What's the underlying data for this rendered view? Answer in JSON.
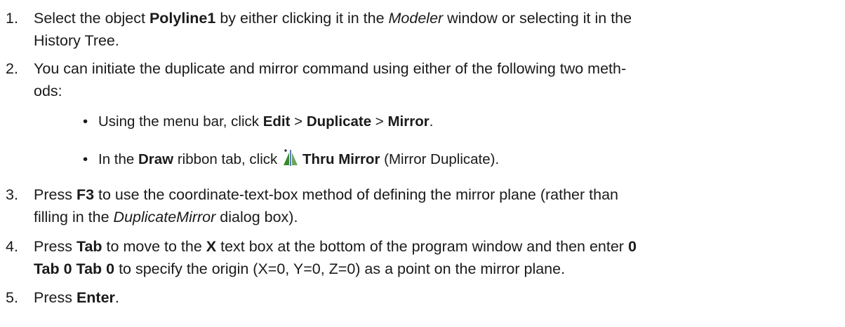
{
  "steps": [
    {
      "number": "1.",
      "parts": [
        "Select the object ",
        "Polyline1",
        " by either clicking it in the ",
        "Modeler",
        " window or selecting it in the",
        "History Tree."
      ]
    },
    {
      "number": "2.",
      "parts": [
        "You can initiate the duplicate and mirror command using either of the following two meth-",
        "ods:"
      ],
      "bullets": [
        {
          "parts": [
            "Using the menu bar, click ",
            "Edit",
            " > ",
            "Duplicate",
            " > ",
            "Mirror",
            "."
          ]
        },
        {
          "parts": [
            "In the ",
            "Draw",
            " ribbon tab, click ",
            "Thru Mirror",
            " (Mirror Duplicate)."
          ],
          "icon": "mirror-duplicate-icon"
        }
      ]
    },
    {
      "number": "3.",
      "parts": [
        "Press ",
        "F3",
        " to use the coordinate-text-box method of defining the mirror plane (rather than",
        "filling in the ",
        "DuplicateMirror",
        " dialog box)."
      ]
    },
    {
      "number": "4.",
      "parts": [
        "Press ",
        "Tab",
        " to move to the ",
        "X",
        " text box at the bottom of the program window and then enter ",
        "0",
        "Tab 0 Tab 0",
        " to specify the origin (X=0, Y=0, Z=0) as a point on the mirror plane."
      ]
    },
    {
      "number": "5.",
      "parts": [
        "Press ",
        "Enter",
        "."
      ]
    }
  ],
  "colors": {
    "text": "#1a1a1a",
    "icon_green": "#3a8a2a",
    "icon_blue": "#2a5db0"
  }
}
